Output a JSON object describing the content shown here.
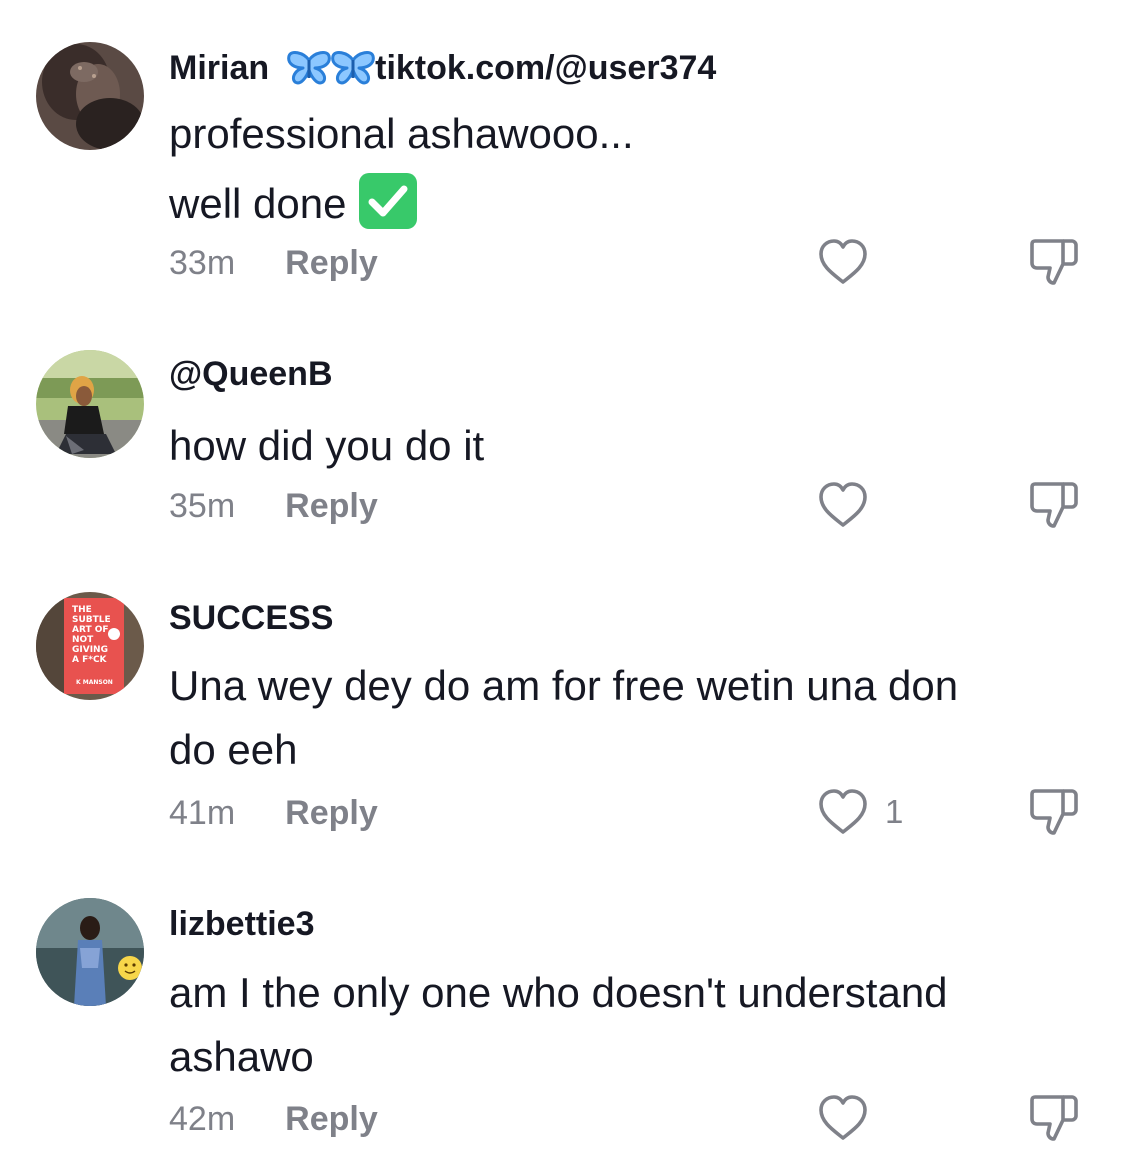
{
  "comments": [
    {
      "username": "Mirian",
      "username_suffix": "tiktok.com/@user374",
      "lines": [
        "professional ashawooo...",
        "well done"
      ],
      "time": "33m",
      "reply_label": "Reply",
      "like_count": ""
    },
    {
      "username": "@QueenB",
      "lines": [
        "how did you do it"
      ],
      "time": "35m",
      "reply_label": "Reply",
      "like_count": ""
    },
    {
      "username": "SUCCESS",
      "lines": [
        "Una wey dey do am for free wetin una don",
        "do eeh"
      ],
      "time": "41m",
      "reply_label": "Reply",
      "like_count": "1"
    },
    {
      "username": "lizbettie3",
      "lines": [
        "am I the only one who doesn't understand",
        "ashawo"
      ],
      "time": "42m",
      "reply_label": "Reply",
      "like_count": ""
    }
  ],
  "avatar_book": {
    "lines": [
      "THE",
      "SUBTLE",
      "ART OF",
      "NOT",
      "GIVING",
      "A F*CK",
      "K MANSON"
    ]
  },
  "icons": {
    "emoji": "check-mark-button-icon",
    "decor": "butterfly-icon",
    "like": "heart-outline-icon",
    "dislike": "thumbs-down-outline-icon"
  },
  "colors": {
    "text": "#161823",
    "muted": "#7f8189",
    "butterfly": "#3a8fe8",
    "check": "#38c96a"
  }
}
